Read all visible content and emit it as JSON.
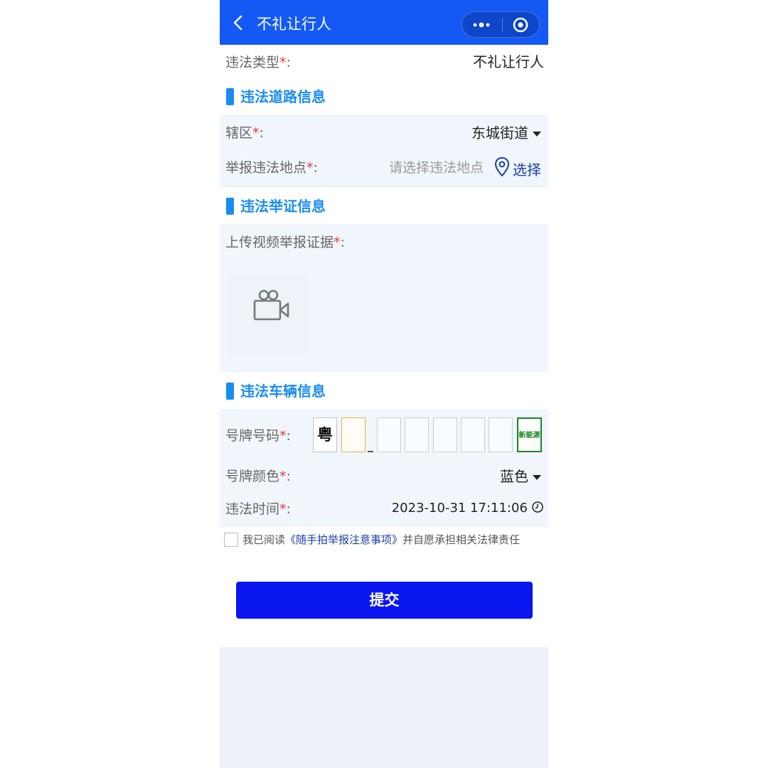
{
  "header": {
    "title": "不礼让行人",
    "back_icon": "chevron-left-icon",
    "more_icon": "more-dots-icon",
    "close_icon": "target-circle-icon",
    "bg_color": "#1559f5"
  },
  "violation_type": {
    "label": "违法类型",
    "required_mark": "*",
    "colon": ":",
    "value": "不礼让行人"
  },
  "road_section": {
    "title": "违法道路信息",
    "district": {
      "label": "辖区",
      "required_mark": "*",
      "colon": ":",
      "value": "东城街道"
    },
    "location": {
      "label": "举报违法地点",
      "required_mark": "*",
      "colon": ":",
      "placeholder": "请选择违法地点",
      "select_label": "选择",
      "icon": "location-pin-icon"
    }
  },
  "evidence_section": {
    "title": "违法举证信息",
    "upload": {
      "label": "上传视频举报证据",
      "required_mark": "*",
      "colon": ":",
      "icon": "video-camera-icon"
    }
  },
  "vehicle_section": {
    "title": "违法车辆信息",
    "plate_number": {
      "label": "号牌号码",
      "required_mark": "*",
      "colon": ":",
      "province": "粤",
      "new_energy": "新能源"
    },
    "plate_color": {
      "label": "号牌颜色",
      "required_mark": "*",
      "colon": ":",
      "value": "蓝色"
    },
    "time": {
      "label": "违法时间",
      "required_mark": "*",
      "colon": ":",
      "value": "2023-10-31 17:11:06",
      "icon": "clock-icon"
    }
  },
  "agreement": {
    "prefix": "我已阅读",
    "link": "《随手拍举报注意事项》",
    "suffix": "并自愿承担相关法律责任",
    "checked": false
  },
  "submit": {
    "label": "提交",
    "color": "#0a16f0"
  },
  "colors": {
    "accent": "#1a8cf0",
    "required": "#e23b3b",
    "panel_bg": "#f1f6fd"
  }
}
